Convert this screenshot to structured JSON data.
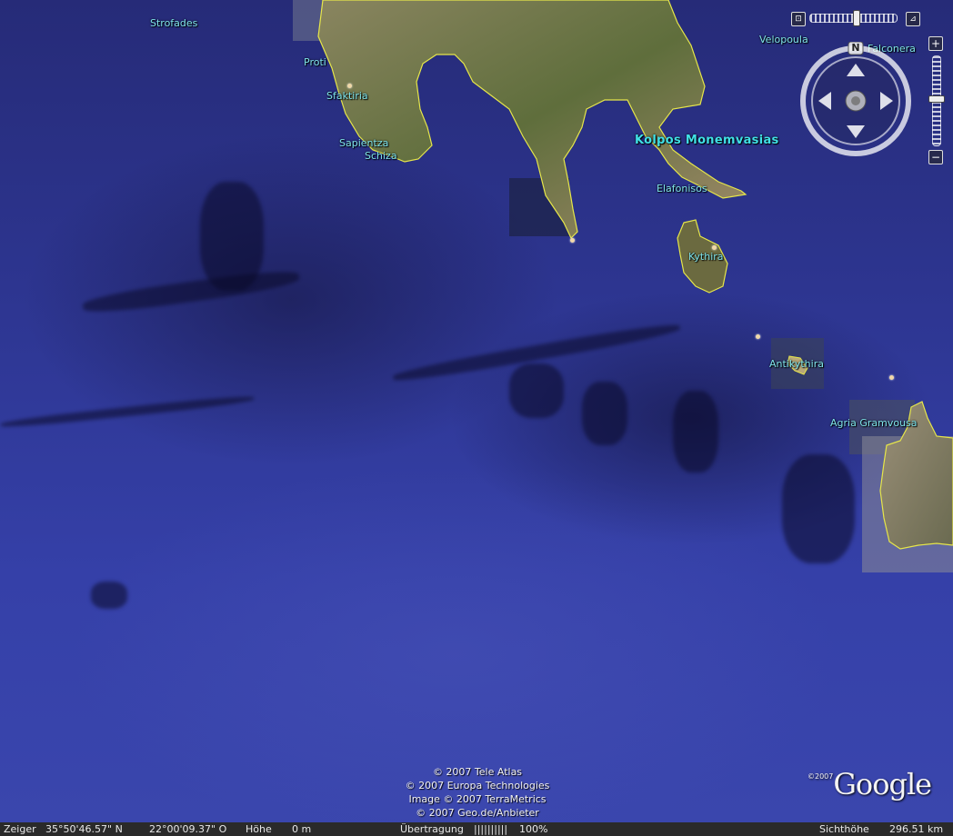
{
  "map": {
    "places": [
      {
        "id": "strofades",
        "label": "Strofades"
      },
      {
        "id": "proti",
        "label": "Proti"
      },
      {
        "id": "sfaktiria",
        "label": "Sfaktiria"
      },
      {
        "id": "sapientza",
        "label": "Sapientza"
      },
      {
        "id": "schiza",
        "label": "Schiza"
      },
      {
        "id": "velopoula",
        "label": "Velopoula"
      },
      {
        "id": "falconera",
        "label": "Falconera"
      },
      {
        "id": "kolpos",
        "label": "Kolpos Monemvasias"
      },
      {
        "id": "elafonisos",
        "label": "Elafonisos"
      },
      {
        "id": "kythira",
        "label": "Kythira"
      },
      {
        "id": "antikythira",
        "label": "Antikythira"
      },
      {
        "id": "gramvousa",
        "label": "Agria Gramvousa"
      }
    ]
  },
  "controls": {
    "north_label": "N",
    "zoom_in": "+",
    "zoom_out": "−"
  },
  "copyright": {
    "line1": "© 2007 Tele Atlas",
    "line2": "© 2007 Europa Technologies",
    "line3": "Image © 2007 TerraMetrics",
    "line4": "© 2007 Geo.de/Anbieter"
  },
  "logo": {
    "year": "©2007",
    "word": "Google"
  },
  "status": {
    "pointer_label": "Zeiger",
    "lat": "35°50'46.57\" N",
    "lon": "22°00'09.37\" O",
    "elev_label": "Höhe",
    "elev_value": "0 m",
    "stream_label": "Übertragung",
    "stream_bars": "||||||||||",
    "stream_percent": "100%",
    "eye_label": "Sichthöhe",
    "eye_value": "296.51 km"
  },
  "colors": {
    "ocean": "#2d3590",
    "land": "#6e7a4a",
    "coastline": "#e6e64a",
    "label": "#7fe3ea"
  }
}
